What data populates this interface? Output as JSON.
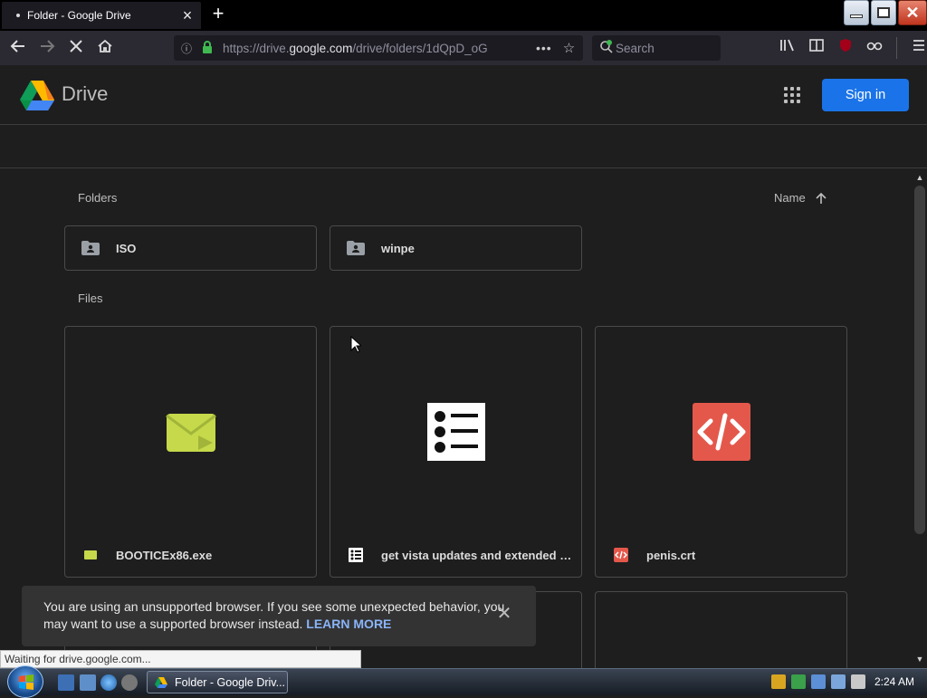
{
  "browser": {
    "tab_title": "Folder - Google Drive",
    "url_prefix": "https://drive.",
    "url_domain": "google.com",
    "url_path": "/drive/folders/1dQpD_oG",
    "search_placeholder": "Search",
    "more_label": "•••"
  },
  "drive": {
    "logo_text": "Drive",
    "signin_label": "Sign in",
    "folders_label": "Folders",
    "files_label": "Files",
    "sort_label": "Name",
    "folders": [
      {
        "name": "ISO"
      },
      {
        "name": "winpe"
      }
    ],
    "files": [
      {
        "name": "BOOTICEx86.exe",
        "type": "executable"
      },
      {
        "name": "get vista updates and extended kernel",
        "type": "list-document"
      },
      {
        "name": "penis.crt",
        "type": "code"
      }
    ]
  },
  "toast": {
    "message": "You are using an unsupported browser. If you see some unexpected behavior, you may want to use a supported browser instead.",
    "link_label": "LEARN MORE"
  },
  "status_bar": {
    "text": "Waiting for drive.google.com..."
  },
  "taskbar": {
    "task_label": "Folder - Google Driv...",
    "clock": "2:24 AM"
  },
  "colors": {
    "accent": "#1a73e8",
    "background": "#1e1e1e",
    "exe_icon": "#c5d94a",
    "code_icon": "#e4584b"
  }
}
